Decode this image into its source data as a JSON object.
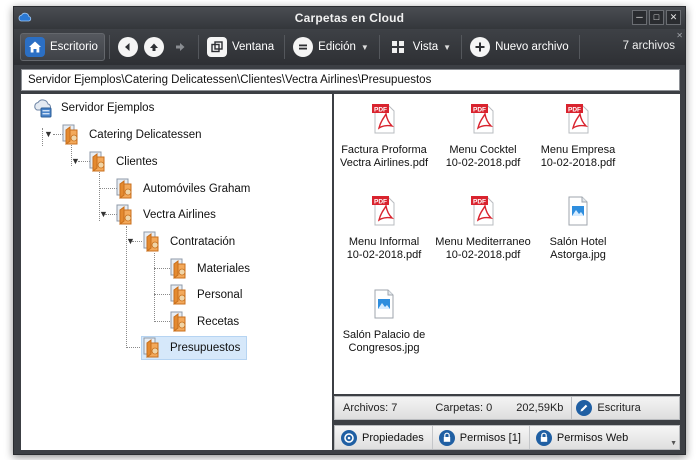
{
  "window": {
    "title": "Carpetas en Cloud",
    "app_icon": "cloud-icon",
    "controls": [
      "minimize-icon",
      "maximize-icon",
      "close-icon"
    ]
  },
  "toolbar": {
    "home_label": "Escritorio",
    "window_label": "Ventana",
    "edit_label": "Edición",
    "view_label": "Vista",
    "new_file_label": "Nuevo archivo",
    "file_count": "7 archivos"
  },
  "pathbar": {
    "value": "Servidor Ejemplos\\Catering Delicatessen\\Clientes\\Vectra Airlines\\Presupuestos"
  },
  "tree": {
    "nodes": [
      {
        "label": "Servidor Ejemplos",
        "icon": "server-cloud-icon"
      },
      {
        "label": "Catering Delicatessen",
        "icon": "folder-doc-icon"
      },
      {
        "label": "Clientes",
        "icon": "folder-doc-icon"
      },
      {
        "label": "Automóviles Graham",
        "icon": "folder-doc-icon"
      },
      {
        "label": "Vectra Airlines",
        "icon": "folder-doc-icon"
      },
      {
        "label": "Contratación",
        "icon": "folder-doc-icon"
      },
      {
        "label": "Materiales",
        "icon": "folder-doc-icon"
      },
      {
        "label": "Personal",
        "icon": "folder-doc-icon"
      },
      {
        "label": "Recetas",
        "icon": "folder-doc-icon"
      },
      {
        "label": "Presupuestos",
        "icon": "folder-doc-icon",
        "selected": true
      }
    ]
  },
  "files": [
    {
      "line1": "Factura Proforma",
      "line2": "Vectra Airlines.pdf",
      "type": "pdf"
    },
    {
      "line1": "Menu Cocktel",
      "line2": "10-02-2018.pdf",
      "type": "pdf"
    },
    {
      "line1": "Menu Empresa",
      "line2": "10-02-2018.pdf",
      "type": "pdf"
    },
    {
      "line1": "Menu Informal",
      "line2": "10-02-2018.pdf",
      "type": "pdf"
    },
    {
      "line1": "Menu Mediterraneo",
      "line2": "10-02-2018.pdf",
      "type": "pdf"
    },
    {
      "line1": "Salón Hotel",
      "line2": "Astorga.jpg",
      "type": "jpg"
    },
    {
      "line1": "Salón Palacio de",
      "line2": "Congresos.jpg",
      "type": "jpg"
    }
  ],
  "pdf_badge": "PDF",
  "status": {
    "files": "Archivos: 7",
    "folders": "Carpetas: 0",
    "size": "202,59Kb",
    "write_label": "Escritura"
  },
  "actions": {
    "properties": "Propiedades",
    "permissions": "Permisos [1]",
    "web_permissions": "Permisos Web"
  },
  "colors": {
    "toolbar_bg": "#34373b",
    "accent_blue": "#1f5fa3",
    "pdf_red": "#d9232e",
    "selection": "#d6e8fa"
  }
}
